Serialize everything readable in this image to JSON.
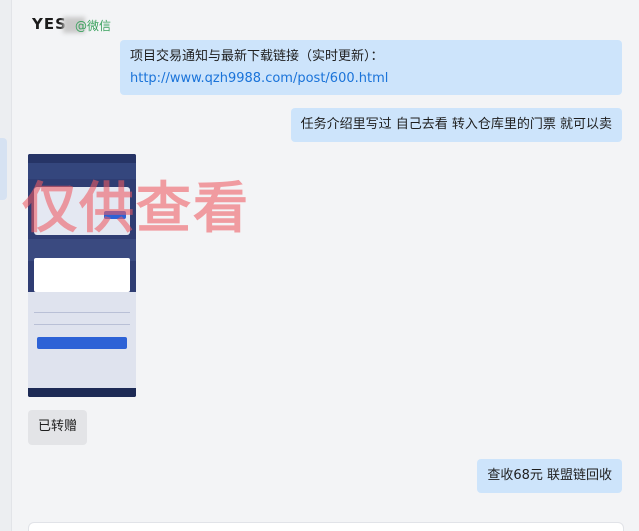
{
  "header": {
    "contact_name": "YES",
    "source_tag": "@微信"
  },
  "messages": [
    {
      "side": "me",
      "prefix": "项目交易通知与最新下载链接（实时更新）：",
      "link": "http://www.qzh9988.com/post/600.html"
    },
    {
      "side": "me",
      "text": "任务介绍里写过  自己去看   转入仓库里的门票  就可以卖"
    },
    {
      "side": "other",
      "type": "image",
      "watermark": "仅供查看"
    },
    {
      "side": "other",
      "text": "已转赠"
    },
    {
      "side": "me",
      "text": "查收68元  联盟链回收"
    }
  ],
  "colors": {
    "my_bubble": "#cde4fb",
    "other_bubble": "#e3e4e7",
    "link": "#1a73d9",
    "watermark": "#ed5c62",
    "source_tag": "#3aa25e"
  }
}
